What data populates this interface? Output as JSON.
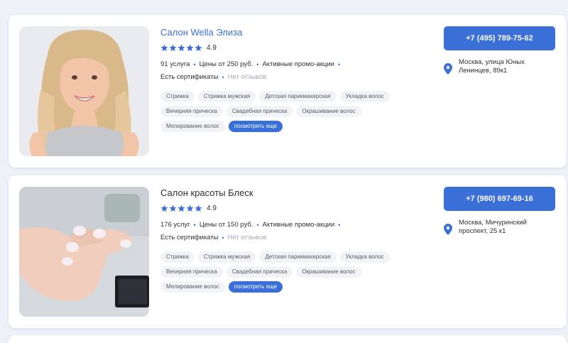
{
  "salons": [
    {
      "name": "Салон Wella Элиза",
      "rating": "4.9",
      "stars": 5,
      "services": "91 услуга",
      "price": "Цены от 250 руб.",
      "promo": "Активные промо-акции",
      "certificates": "Есть сертификаты",
      "reviews": "Нет отзывов",
      "tags": [
        "Стрижка",
        "Стрижка мужская",
        "Детская парикмахерская",
        "Укладка волос",
        "Вечерняя прическа",
        "Свадебная прическа",
        "Окрашивание волос",
        "Мелирование волос"
      ],
      "more_label": "посмотреть еще",
      "phone": "+7 (495) 789-75-62",
      "address": "Москва, улица Юных Ленинцев, 89к1",
      "photo_icon": "woman-portrait-photo"
    },
    {
      "name": "Салон красоты Блеск",
      "rating": "4.9",
      "stars": 5,
      "services": "176 услуг",
      "price": "Цены от 150 руб.",
      "promo": "Активные промо-акции",
      "certificates": "Есть сертификаты",
      "reviews": "Нет отзывов",
      "tags": [
        "Стрижка",
        "Стрижка мужская",
        "Детская парикмахерская",
        "Укладка волос",
        "Вечерняя прическа",
        "Свадебная прическа",
        "Окрашивание волос",
        "Мелирование волос"
      ],
      "more_label": "посмотреть еще",
      "phone": "+7 (980) 697-69-16",
      "address": "Москва, Мичуринский проспект, 25 к1",
      "photo_icon": "manicure-hand-photo"
    }
  ],
  "colors": {
    "accent": "#3b6fd8",
    "background": "#eef2f8",
    "card": "#ffffff",
    "tag_bg": "#f1f3f7",
    "muted": "#a3a9b3"
  }
}
